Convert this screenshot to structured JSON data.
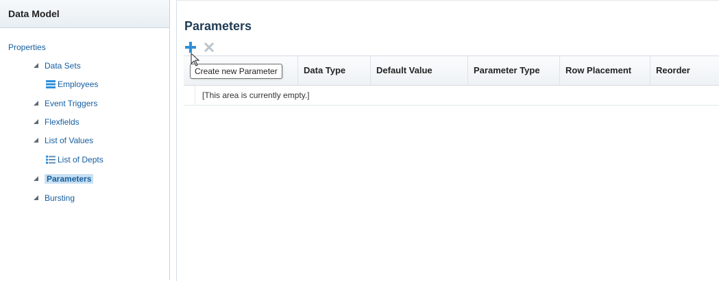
{
  "left_panel": {
    "title": "Data Model",
    "tree": {
      "properties": "Properties",
      "data_sets": "Data Sets",
      "employees": "Employees",
      "event_triggers": "Event Triggers",
      "flexfields": "Flexfields",
      "list_of_values": "List of Values",
      "list_of_depts": "List of Depts",
      "parameters": "Parameters",
      "bursting": "Bursting"
    }
  },
  "main": {
    "title": "Parameters",
    "toolbar": {
      "add_icon": "plus-icon",
      "delete_icon": "x-icon",
      "tooltip": "Create new Parameter"
    },
    "table": {
      "columns": [
        "Data Type",
        "Default Value",
        "Parameter Type",
        "Row Placement",
        "Reorder"
      ],
      "empty_message": "[This area is currently empty.]"
    }
  },
  "colors": {
    "link": "#145c9e",
    "selected_bg": "#c8e0f2",
    "add_icon": "#2f8fd8",
    "delete_icon": "#b9c3cb"
  }
}
